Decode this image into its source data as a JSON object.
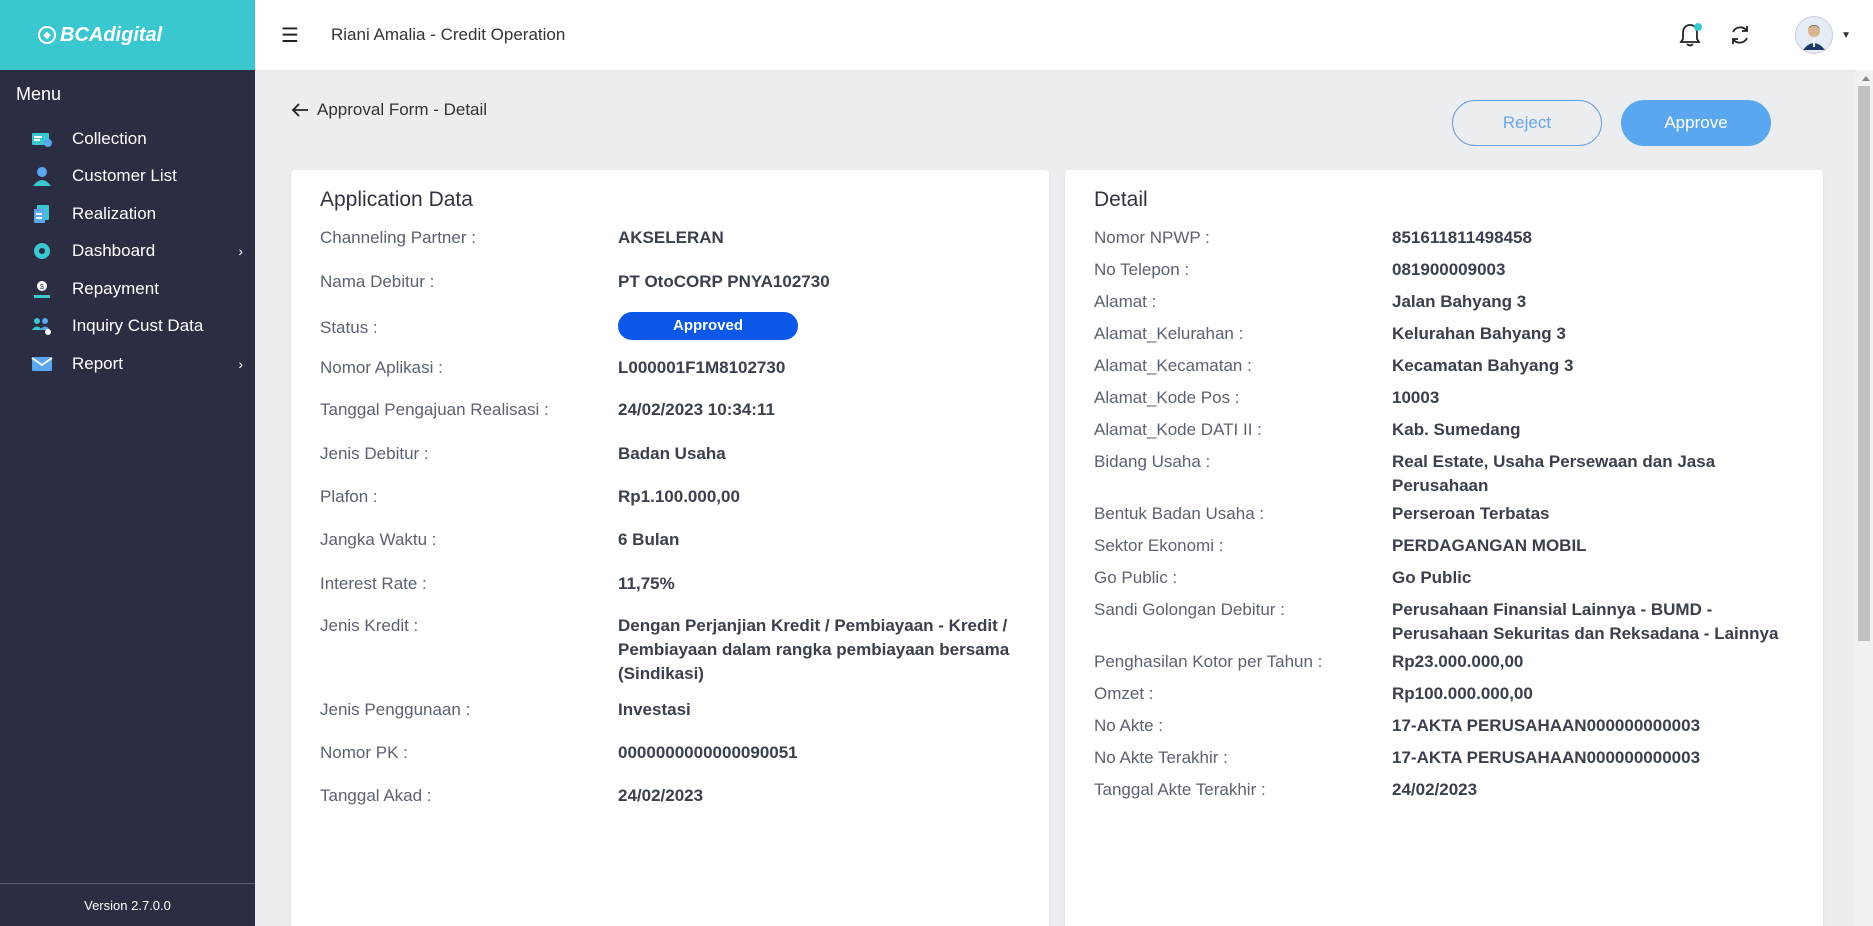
{
  "brand": {
    "logo_text": "BCAdigital"
  },
  "sidebar": {
    "menu_title": "Menu",
    "items": [
      {
        "label": "Collection",
        "icon": "collection-icon",
        "has_submenu": false
      },
      {
        "label": "Customer List",
        "icon": "user-icon",
        "has_submenu": false
      },
      {
        "label": "Realization",
        "icon": "document-icon",
        "has_submenu": false
      },
      {
        "label": "Dashboard",
        "icon": "dashboard-icon",
        "has_submenu": true
      },
      {
        "label": "Repayment",
        "icon": "repayment-icon",
        "has_submenu": false
      },
      {
        "label": "Inquiry Cust Data",
        "icon": "users-icon",
        "has_submenu": false
      },
      {
        "label": "Report",
        "icon": "mail-icon",
        "has_submenu": true
      }
    ],
    "version": "Version 2.7.0.0"
  },
  "topbar": {
    "title": "Riani Amalia - Credit Operation",
    "notification_dot_color": "#3ac7cf"
  },
  "page": {
    "back_label": "Approval Form - Detail",
    "reject_label": "Reject",
    "approve_label": "Approve"
  },
  "application_data": {
    "title": "Application Data",
    "rows": [
      {
        "label": "Channeling Partner :",
        "value": "AKSELERAN"
      },
      {
        "label": "Nama Debitur :",
        "value": "PT OtoCORP PNYA102730"
      },
      {
        "label": "Status :",
        "value": "Approved",
        "badge": true
      },
      {
        "label": "Nomor Aplikasi :",
        "value": "L000001F1M8102730"
      },
      {
        "label": "Tanggal Pengajuan Realisasi :",
        "value": "24/02/2023 10:34:11"
      },
      {
        "label": "Jenis Debitur :",
        "value": "Badan Usaha"
      },
      {
        "label": "Plafon :",
        "value": "Rp1.100.000,00"
      },
      {
        "label": "Jangka Waktu :",
        "value": "6 Bulan"
      },
      {
        "label": "Interest Rate :",
        "value": "11,75%"
      },
      {
        "label": "Jenis Kredit :",
        "value": "Dengan Perjanjian Kredit / Pembiayaan - Kredit / Pembiayaan dalam rangka pembiayaan bersama (Sindikasi)"
      },
      {
        "label": "Jenis Penggunaan :",
        "value": "Investasi"
      },
      {
        "label": "Nomor PK :",
        "value": "0000000000000090051"
      },
      {
        "label": "Tanggal Akad :",
        "value": "24/02/2023"
      }
    ]
  },
  "detail": {
    "title": "Detail",
    "rows": [
      {
        "label": "Nomor NPWP :",
        "value": "851611811498458"
      },
      {
        "label": "No Telepon :",
        "value": "081900009003"
      },
      {
        "label": "Alamat :",
        "value": "Jalan Bahyang 3"
      },
      {
        "label": "Alamat_Kelurahan :",
        "value": "Kelurahan Bahyang 3"
      },
      {
        "label": "Alamat_Kecamatan :",
        "value": "Kecamatan Bahyang 3"
      },
      {
        "label": "Alamat_Kode Pos :",
        "value": "10003"
      },
      {
        "label": "Alamat_Kode DATI II :",
        "value": "Kab. Sumedang"
      },
      {
        "label": "Bidang Usaha :",
        "value": "Real Estate, Usaha Persewaan dan Jasa Perusahaan"
      },
      {
        "label": "Bentuk Badan Usaha :",
        "value": "Perseroan Terbatas"
      },
      {
        "label": "Sektor Ekonomi :",
        "value": "PERDAGANGAN MOBIL"
      },
      {
        "label": "Go Public :",
        "value": "Go Public"
      },
      {
        "label": "Sandi Golongan Debitur :",
        "value": "Perusahaan Finansial Lainnya - BUMD - Perusahaan Sekuritas dan Reksadana - Lainnya"
      },
      {
        "label": "Penghasilan Kotor per Tahun :",
        "value": "Rp23.000.000,00"
      },
      {
        "label": "Omzet :",
        "value": "Rp100.000.000,00"
      },
      {
        "label": "No Akte :",
        "value": "17-AKTA PERUSAHAAN000000000003"
      },
      {
        "label": "No Akte Terakhir :",
        "value": "17-AKTA PERUSAHAAN000000000003"
      },
      {
        "label": "Tanggal Akte Terakhir :",
        "value": "24/02/2023"
      }
    ]
  }
}
